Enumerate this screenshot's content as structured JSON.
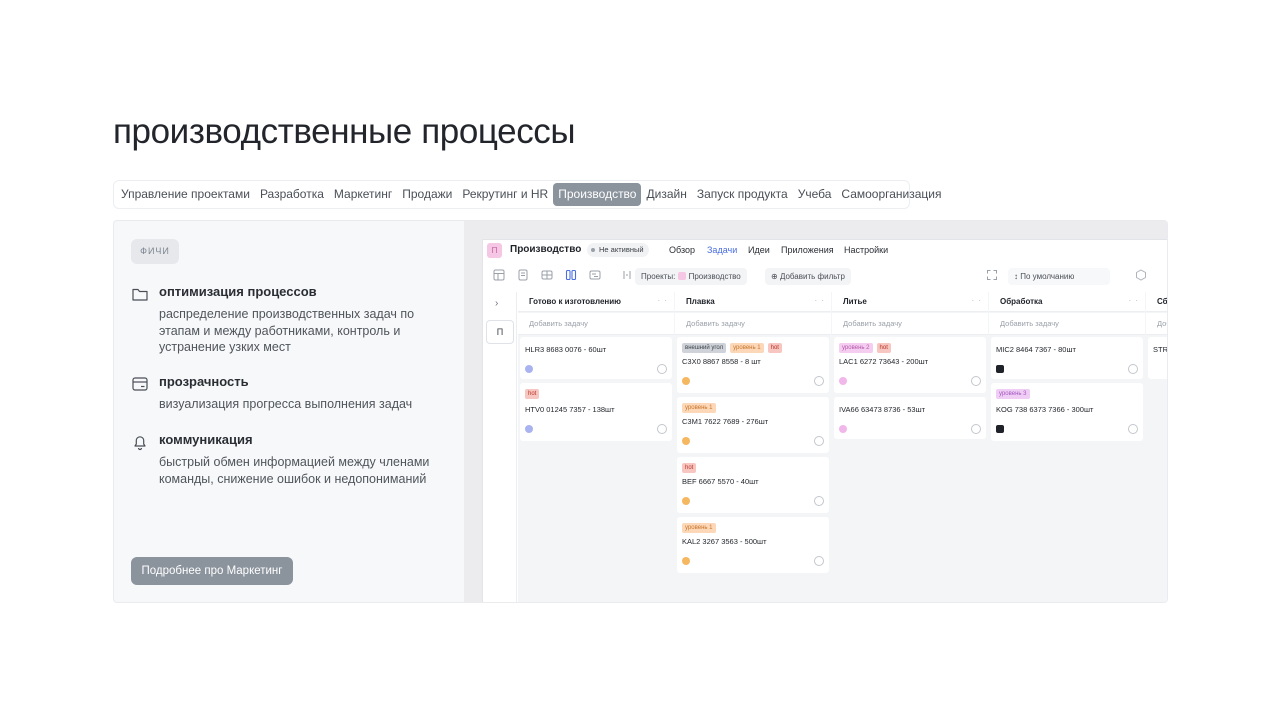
{
  "page": {
    "heading": "производственные процессы"
  },
  "tabs": [
    {
      "label": "Управление проектами",
      "active": false
    },
    {
      "label": "Разработка",
      "active": false
    },
    {
      "label": "Маркетинг",
      "active": false
    },
    {
      "label": "Продажи",
      "active": false
    },
    {
      "label": "Рекрутинг и HR",
      "active": false
    },
    {
      "label": "Производство",
      "active": true
    },
    {
      "label": "Дизайн",
      "active": false
    },
    {
      "label": "Запуск продукта",
      "active": false
    },
    {
      "label": "Учеба",
      "active": false
    },
    {
      "label": "Самоорганизация",
      "active": false
    }
  ],
  "features_panel": {
    "badge": "ФИЧИ",
    "items": [
      {
        "icon": "folder-icon",
        "title": "оптимизация процессов",
        "desc": "распределение производственных задач по этапам и между работниками, контроль и устранение узких мест"
      },
      {
        "icon": "card-icon",
        "title": "прозрачность",
        "desc": "визуализация прогресса выполнения задач"
      },
      {
        "icon": "bell-icon",
        "title": "коммуникация",
        "desc": "быстрый обмен информацией между членами команды, снижение ошибок и недопониманий"
      }
    ],
    "more_button": "Подробнее про Маркетинг"
  },
  "app": {
    "project_avatar": "П",
    "project_name": "Производство",
    "status": "Не активный",
    "nav": [
      "Обзор",
      "Задачи",
      "Идеи",
      "Приложения",
      "Настройки"
    ],
    "nav_active": "Задачи",
    "toolbar": {
      "projects_label": "Проекты:",
      "project_chip": "Производство",
      "add_filter": "Добавить фильтр",
      "sort": "По умолчанию"
    },
    "sidebar": {
      "chevron": "›",
      "project_letter": "П"
    },
    "add_task": "Добавить задачу",
    "columns": [
      {
        "title": "Готово к изготовлению",
        "cards": [
          {
            "tags": [],
            "title": "HLR3 8683 0076 - 60шт",
            "avatar": "blue"
          },
          {
            "tags": [
              {
                "text": "hot",
                "kind": "hot"
              }
            ],
            "title": "HTV0 01245 7357 - 138шт",
            "avatar": "blue"
          }
        ]
      },
      {
        "title": "Плавка",
        "cards": [
          {
            "tags": [
              {
                "text": "внешний угол",
                "kind": "outer"
              },
              {
                "text": "уровень 1",
                "kind": "lvl1"
              },
              {
                "text": "hot",
                "kind": "hot"
              }
            ],
            "title": "C3X0 8867 8558 - 8 шт",
            "avatar": "orange"
          },
          {
            "tags": [
              {
                "text": "уровень 1",
                "kind": "lvl1"
              }
            ],
            "title": "C3M1 7622 7689 - 276шт",
            "avatar": "orange"
          },
          {
            "tags": [
              {
                "text": "hot",
                "kind": "hot"
              }
            ],
            "title": "BEF 6667 5570 - 40шт",
            "avatar": "orange"
          },
          {
            "tags": [
              {
                "text": "уровень 1",
                "kind": "lvl1"
              }
            ],
            "title": "KAL2 3267 3563 - 500шт",
            "avatar": "orange"
          }
        ]
      },
      {
        "title": "Литье",
        "cards": [
          {
            "tags": [
              {
                "text": "уровень 2",
                "kind": "lvl2"
              },
              {
                "text": "hot",
                "kind": "hot"
              }
            ],
            "title": "LAC1 6272 73643 - 200шт",
            "avatar": "pink"
          },
          {
            "tags": [],
            "title": "IVA66 63473 8736 - 53шт",
            "avatar": "pink"
          }
        ]
      },
      {
        "title": "Обработка",
        "cards": [
          {
            "tags": [],
            "title": "MIC2 8464 7367 - 80шт",
            "avatar": "dark"
          },
          {
            "tags": [
              {
                "text": "уровень 3",
                "kind": "lvl3"
              }
            ],
            "title": "KOG 738 6373 7366 - 300шт",
            "avatar": "dark"
          }
        ]
      },
      {
        "title": "Сб",
        "add_task": "Доб",
        "cards": [
          {
            "tags": [],
            "title": "STR",
            "avatar": null
          }
        ]
      }
    ]
  }
}
